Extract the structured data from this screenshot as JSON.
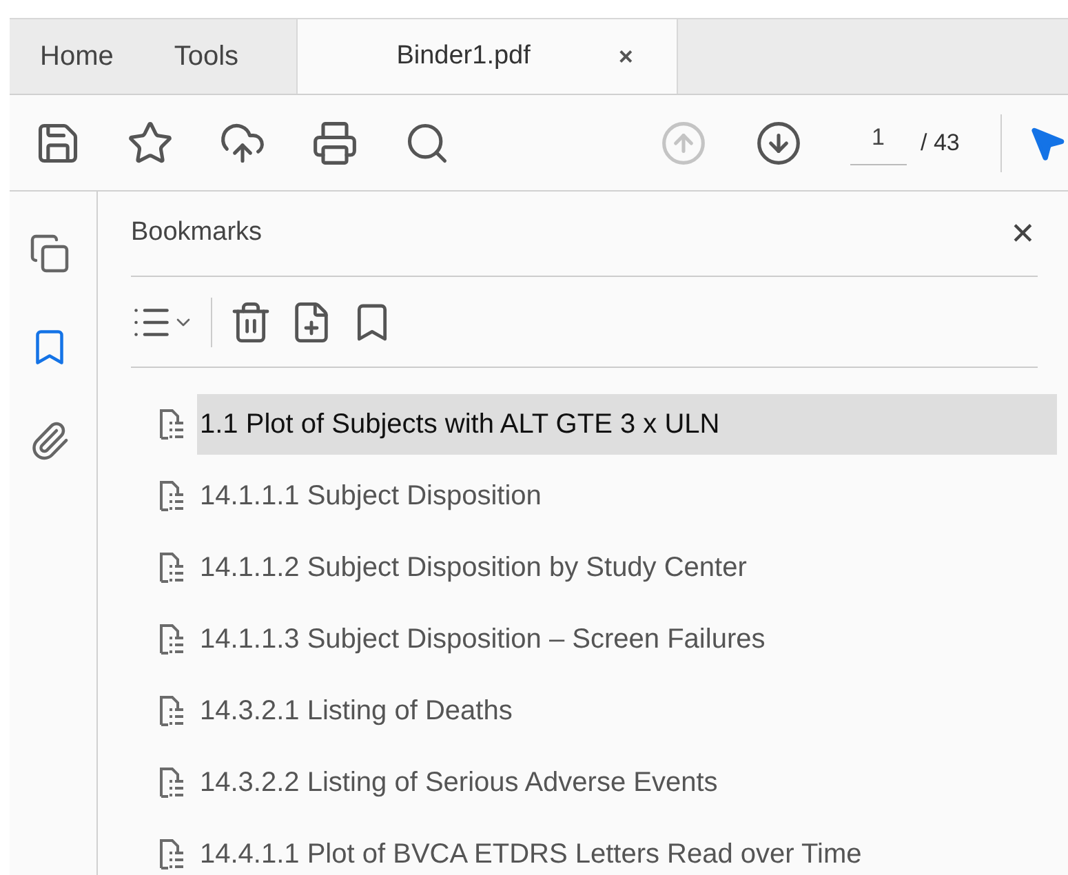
{
  "tabs": [
    {
      "label": "Home",
      "selected": false
    },
    {
      "label": "Tools",
      "selected": false
    },
    {
      "label": "Binder1.pdf",
      "selected": true,
      "close": "×"
    }
  ],
  "toolbar": {
    "items": [
      {
        "kind": "save"
      },
      {
        "kind": "star"
      },
      {
        "kind": "upload"
      },
      {
        "kind": "print"
      },
      {
        "kind": "zoom"
      },
      {
        "kind": "prev",
        "disabled": true
      },
      {
        "kind": "next",
        "disabled": false
      }
    ],
    "page": "1",
    "total": "/ 43"
  },
  "rail": [
    {
      "kind": "pages",
      "selected": false
    },
    {
      "kind": "bookmarks",
      "selected": true
    },
    {
      "kind": "attachments",
      "selected": false
    }
  ],
  "panel": {
    "title": "Bookmarks",
    "close": "✕",
    "bookmarks": [
      {
        "label": "1.1 Plot of Subjects with ALT GTE 3 x ULN",
        "selected": true
      },
      {
        "label": "14.1.1.1 Subject Disposition",
        "selected": false
      },
      {
        "label": "14.1.1.2 Subject Disposition by Study Center",
        "selected": false
      },
      {
        "label": "14.1.1.3 Subject Disposition – Screen Failures",
        "selected": false
      },
      {
        "label": "14.3.2.1 Listing of Deaths",
        "selected": false
      },
      {
        "label": "14.3.2.2 Listing of Serious Adverse Events",
        "selected": false
      },
      {
        "label": "14.4.1.1 Plot of BVCA ETDRS Letters Read over Time",
        "selected": false
      }
    ]
  }
}
